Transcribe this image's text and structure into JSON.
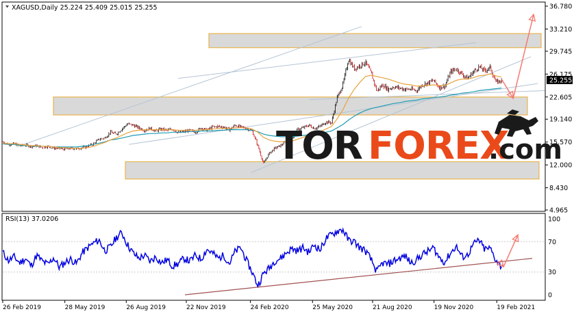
{
  "window": {
    "header": "XAGUSD,Daily  25.224 25.409 25.015 25.255"
  },
  "chart_data": [
    {
      "type": "line",
      "title": "XAGUSD,Daily",
      "ohlc": {
        "open": 25.224,
        "high": 25.409,
        "low": 25.015,
        "close": 25.255
      },
      "current_price": 25.255,
      "price_tick_labels": [
        "36.780",
        "33.210",
        "29.745",
        "26.175",
        "22.605",
        "19.140",
        "15.570",
        "12.000",
        "8.430",
        "4.965"
      ],
      "ylim": [
        4.965,
        36.78
      ],
      "x_tick_labels": [
        "26 Feb 2019",
        "28 May 2019",
        "26 Aug 2019",
        "22 Nov 2019",
        "24 Feb 2020",
        "25 May 2020",
        "21 Aug 2020",
        "19 Nov 2020",
        "19 Feb 2021"
      ],
      "x_period": [
        "2019-02-26",
        "2021-04-30"
      ],
      "x_data_end": "2021-02-26",
      "price_series_weekly": [
        15.6,
        15.2,
        15.3,
        15.0,
        15.1,
        14.9,
        15.0,
        14.7,
        14.9,
        14.6,
        14.6,
        14.4,
        14.6,
        14.5,
        14.7,
        14.9,
        15.3,
        16.0,
        16.2,
        17.1,
        16.8,
        17.6,
        18.4,
        18.2,
        17.8,
        17.4,
        17.7,
        17.3,
        17.6,
        17.4,
        17.6,
        17.0,
        17.2,
        17.4,
        17.1,
        17.8,
        17.4,
        17.9,
        18.0,
        17.9,
        17.5,
        18.2,
        17.9,
        17.7,
        17.3,
        15.0,
        12.2,
        13.8,
        14.6,
        15.0,
        15.7,
        16.1,
        17.5,
        17.8,
        18.2,
        17.7,
        18.0,
        18.7,
        18.6,
        22.5,
        24.5,
        28.5,
        27.0,
        27.5,
        28.0,
        26.3,
        23.5,
        24.5,
        23.8,
        24.2,
        24.0,
        23.8,
        23.8,
        23.6,
        24.5,
        24.8,
        25.2,
        24.1,
        24.3,
        26.5,
        27.0,
        26.2,
        25.5,
        26.5,
        27.3,
        26.7,
        27.2,
        24.9,
        25.2
      ],
      "ma_slow_weekly": [
        15.3,
        15.2,
        15.2,
        15.1,
        15.0,
        15.0,
        14.9,
        14.9,
        14.9,
        14.8,
        14.8,
        14.8,
        14.8,
        14.8,
        14.9,
        15.0,
        15.2,
        15.4,
        15.6,
        15.9,
        16.0,
        16.2,
        16.4,
        16.6,
        16.7,
        16.8,
        16.9,
        16.9,
        17.0,
        17.0,
        17.1,
        17.1,
        17.1,
        17.2,
        17.2,
        17.3,
        17.3,
        17.3,
        17.4,
        17.4,
        17.5,
        17.5,
        17.5,
        17.5,
        17.4,
        17.2,
        16.8,
        16.6,
        16.5,
        16.4,
        16.4,
        16.4,
        16.5,
        16.6,
        16.7,
        16.8,
        16.9,
        17.1,
        17.3,
        17.8,
        18.3,
        19.0,
        19.6,
        20.1,
        20.5,
        20.8,
        21.0,
        21.2,
        21.4,
        21.6,
        21.7,
        21.9,
        22.0,
        22.1,
        22.3,
        22.4,
        22.5,
        22.6,
        22.7,
        22.9,
        23.0,
        23.2,
        23.3,
        23.4,
        23.6,
        23.7,
        23.8,
        23.9,
        24.0
      ],
      "ma_fast_weekly": [
        15.4,
        15.3,
        15.3,
        15.2,
        15.1,
        15.0,
        15.0,
        14.9,
        14.9,
        14.8,
        14.7,
        14.7,
        14.6,
        14.6,
        14.6,
        14.7,
        14.9,
        15.2,
        15.5,
        15.9,
        16.2,
        16.6,
        17.0,
        17.3,
        17.4,
        17.5,
        17.5,
        17.5,
        17.5,
        17.5,
        17.5,
        17.4,
        17.4,
        17.4,
        17.4,
        17.5,
        17.5,
        17.6,
        17.7,
        17.7,
        17.7,
        17.8,
        17.8,
        17.8,
        17.6,
        17.1,
        16.3,
        15.9,
        15.7,
        15.6,
        15.6,
        15.7,
        16.0,
        16.3,
        16.7,
        16.9,
        17.2,
        17.6,
        18.0,
        19.2,
        20.6,
        22.4,
        23.8,
        24.9,
        25.8,
        26.0,
        25.8,
        25.6,
        25.4,
        25.1,
        24.8,
        24.6,
        24.5,
        24.3,
        24.3,
        24.4,
        24.5,
        24.4,
        24.4,
        24.8,
        25.2,
        25.4,
        25.4,
        25.6,
        25.9,
        26.0,
        26.2,
        25.9,
        25.7
      ],
      "support_resistance_zones": [
        {
          "from": 30.3,
          "to": 32.5
        },
        {
          "from": 19.8,
          "to": 22.6
        },
        {
          "from": 9.8,
          "to": 12.5
        }
      ],
      "forecast_arrow": [
        {
          "date": "2021-02-26",
          "value": 25.4
        },
        {
          "date": "2021-03-15",
          "value": 22.4
        },
        {
          "date": "2021-04-14",
          "value": 35.5
        }
      ]
    },
    {
      "type": "line",
      "title": "RSI(13) 37.0206",
      "indicator": "RSI",
      "period": 13,
      "current_value": 37.0206,
      "y_tick_labels": [
        "100",
        "70",
        "30",
        "0"
      ],
      "ylim": [
        0,
        100
      ],
      "levels": [
        70,
        30
      ],
      "rsi_weekly": [
        56,
        45,
        50,
        42,
        48,
        38,
        52,
        44,
        40,
        49,
        36,
        43,
        47,
        41,
        55,
        62,
        68,
        72,
        58,
        63,
        75,
        82,
        66,
        55,
        48,
        52,
        44,
        50,
        42,
        46,
        38,
        41,
        48,
        44,
        52,
        47,
        60,
        55,
        48,
        52,
        41,
        57,
        62,
        45,
        30,
        12,
        28,
        35,
        45,
        48,
        55,
        61,
        58,
        62,
        56,
        66,
        59,
        74,
        79,
        84,
        86,
        72,
        70,
        62,
        58,
        46,
        30,
        42,
        40,
        45,
        48,
        51,
        42,
        46,
        53,
        57,
        62,
        49,
        43,
        55,
        64,
        50,
        52,
        66,
        72,
        60,
        61,
        46,
        37
      ],
      "trendline": [
        {
          "date": "2019-11-20",
          "value": 0
        },
        {
          "date": "2021-04-12",
          "value": 48
        }
      ],
      "forecast_arrow": [
        {
          "date": "2021-02-26",
          "value": 40
        },
        {
          "date": "2021-03-01",
          "value": 37
        },
        {
          "date": "2021-03-22",
          "value": 79
        }
      ]
    }
  ],
  "watermark": {
    "prefix": "TOR",
    "brand": "FOREX",
    "suffix": ".com"
  },
  "colors": {
    "bull_candle": "#000000",
    "bear_candle": "#c00000",
    "ma_fast": "#e8a23a",
    "ma_slow": "#1e9bb4",
    "channel_line": "#b4c4d4",
    "zone_fill": "#d9d9d9",
    "zone_border": "#e8b44c",
    "forecast_arrow": "#f47a72",
    "rsi_line": "#0000e0",
    "rsi_trendline": "#a05050",
    "watermark_dark": "#1a1a1a",
    "watermark_accent": "#ea4a1a",
    "price_box": "#000000"
  }
}
